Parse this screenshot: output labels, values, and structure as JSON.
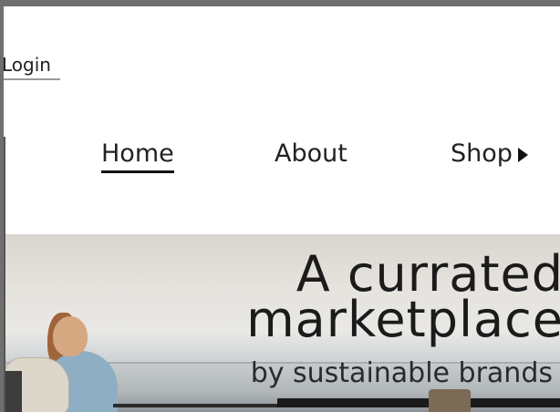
{
  "header": {
    "login_label": "Login"
  },
  "nav": {
    "items": [
      {
        "label": "Home",
        "active": true
      },
      {
        "label": "About"
      },
      {
        "label": "Shop",
        "icon": "caret-right-icon"
      }
    ]
  },
  "hero": {
    "title_line1": "A currated",
    "title_line2": "marketplace",
    "subtitle": "by sustainable brands"
  }
}
